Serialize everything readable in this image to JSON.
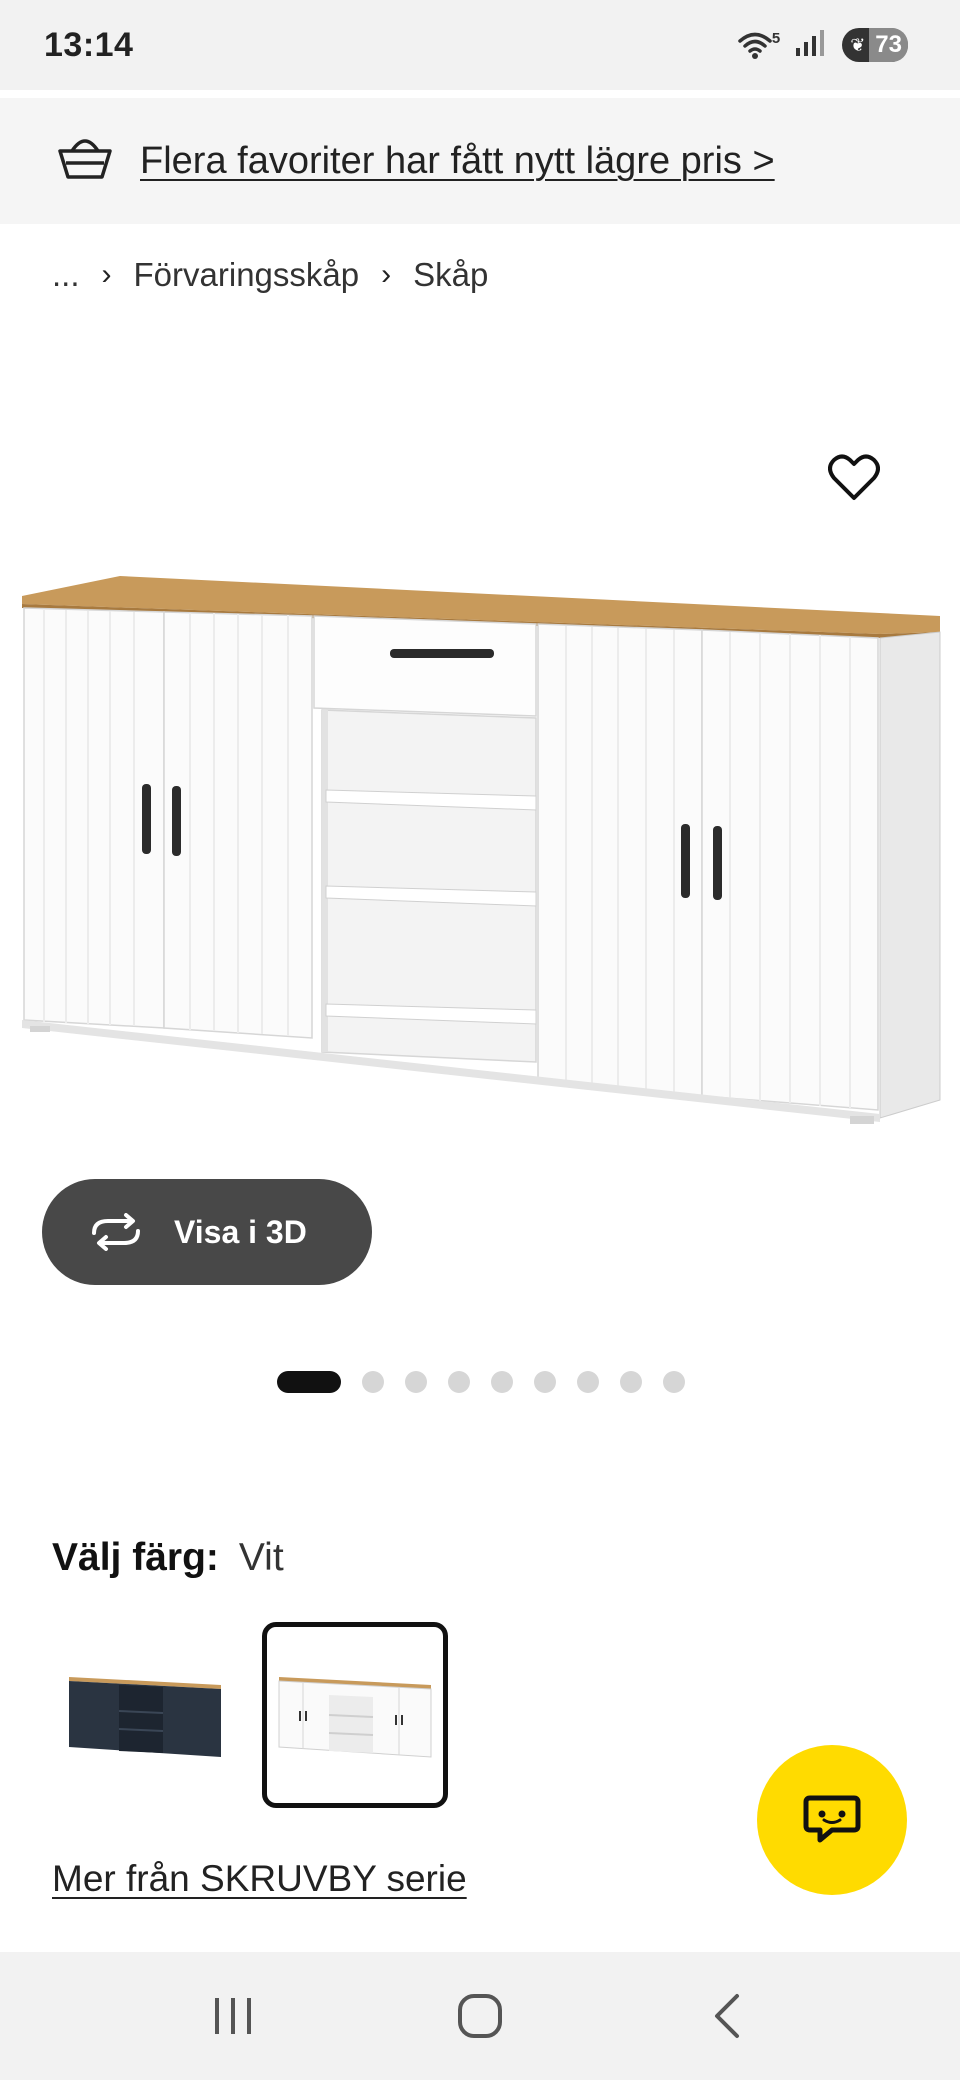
{
  "status_bar": {
    "time": "13:14",
    "wifi_label": "5",
    "battery_level": "73",
    "icons": [
      "wifi-icon",
      "signal-icon",
      "battery-icon"
    ]
  },
  "promo": {
    "text": "Flera favoriter har fått nytt lägre pris >",
    "icon": "basket-icon"
  },
  "breadcrumb": {
    "items": [
      "...",
      "Förvaringsskåp",
      "Skåp"
    ],
    "separator": "›"
  },
  "product": {
    "view_3d_label": "Visa i 3D",
    "image_count": 9,
    "active_image": 1
  },
  "color": {
    "label": "Välj färg:",
    "value": "Vit",
    "options": [
      {
        "color": "#2a3441"
      },
      {
        "color": "#ffffff",
        "selected": true
      }
    ]
  },
  "series_link": "Mer från SKRUVBY serie",
  "colors": {
    "chat_fab": "#ffdb00",
    "button_3d": "#484848",
    "wood_top": "#c89a5b"
  }
}
